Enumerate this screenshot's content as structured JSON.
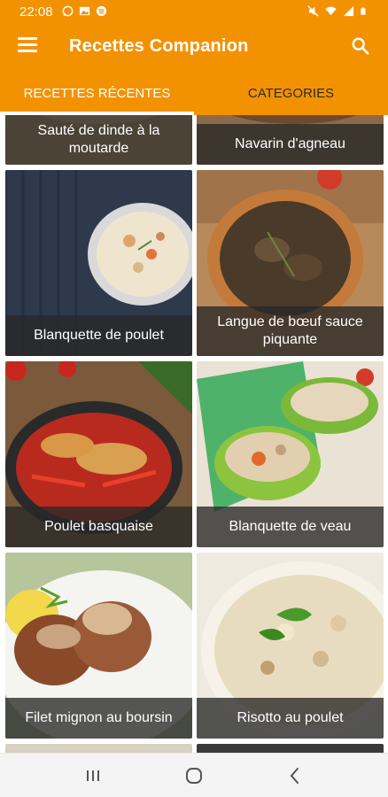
{
  "status_bar": {
    "time": "22:08",
    "left_icons": [
      "whatsapp-icon",
      "gallery-icon",
      "spotify-icon"
    ],
    "right_icons": [
      "mute-icon",
      "wifi-icon",
      "signal-icon",
      "battery-icon"
    ]
  },
  "app_bar": {
    "title": "Recettes Companion",
    "menu_icon": "hamburger-menu-icon",
    "search_icon": "search-icon"
  },
  "tabs": [
    {
      "label": "RECETTES RÉCENTES",
      "active": true
    },
    {
      "label": "CATEGORIES",
      "active": false
    }
  ],
  "recipes": [
    {
      "title": "Sauté de dinde à la moutarde"
    },
    {
      "title": "Navarin d'agneau"
    },
    {
      "title": "Blanquette de poulet"
    },
    {
      "title": "Langue de bœuf sauce piquante"
    },
    {
      "title": "Poulet basquaise"
    },
    {
      "title": "Blanquette de veau"
    },
    {
      "title": "Filet mignon au boursin"
    },
    {
      "title": "Risotto au poulet"
    }
  ],
  "colors": {
    "accent": "#f39200",
    "caption_bg": "#282828",
    "nav_bg": "#f4f4f4"
  },
  "nav_bar": {
    "buttons": [
      "recent-apps-icon",
      "home-icon",
      "back-icon"
    ]
  }
}
